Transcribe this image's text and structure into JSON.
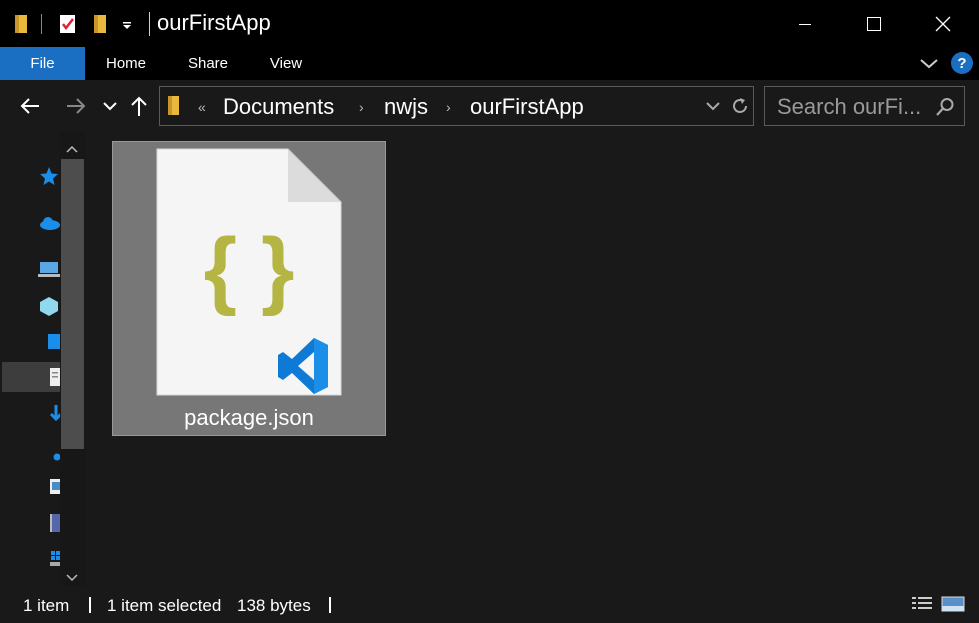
{
  "window": {
    "title": "ourFirstApp",
    "minimize_glyph": "—",
    "maximize_glyph": "☐",
    "close_glyph": "✕"
  },
  "ribbon": {
    "tabs": [
      {
        "label": "File",
        "active": true
      },
      {
        "label": "Home",
        "active": false
      },
      {
        "label": "Share",
        "active": false
      },
      {
        "label": "View",
        "active": false
      }
    ],
    "expand_glyph": "∨",
    "help_glyph": "?"
  },
  "nav": {
    "back_glyph": "←",
    "forward_glyph": "→",
    "recent_glyph": "∨",
    "up_glyph": "↑"
  },
  "address": {
    "overflow_glyph": "«",
    "crumbs": [
      "Documents",
      "nwjs",
      "ourFirstApp"
    ],
    "separator_glyph": "›",
    "dropdown_glyph": "∨",
    "refresh_glyph": "↻"
  },
  "search": {
    "placeholder": "Search ourFi..."
  },
  "files": [
    {
      "name": "package.json",
      "type": "json",
      "selected": true,
      "icon_text": "{ }"
    }
  ],
  "status": {
    "item_count": "1 item",
    "selection": "1 item selected",
    "size": "138 bytes"
  },
  "colors": {
    "accent": "#1a6fc2",
    "json_braces": "#b5b543",
    "vscode_blue": "#0f7ad5",
    "selection_tile": "#777777"
  }
}
